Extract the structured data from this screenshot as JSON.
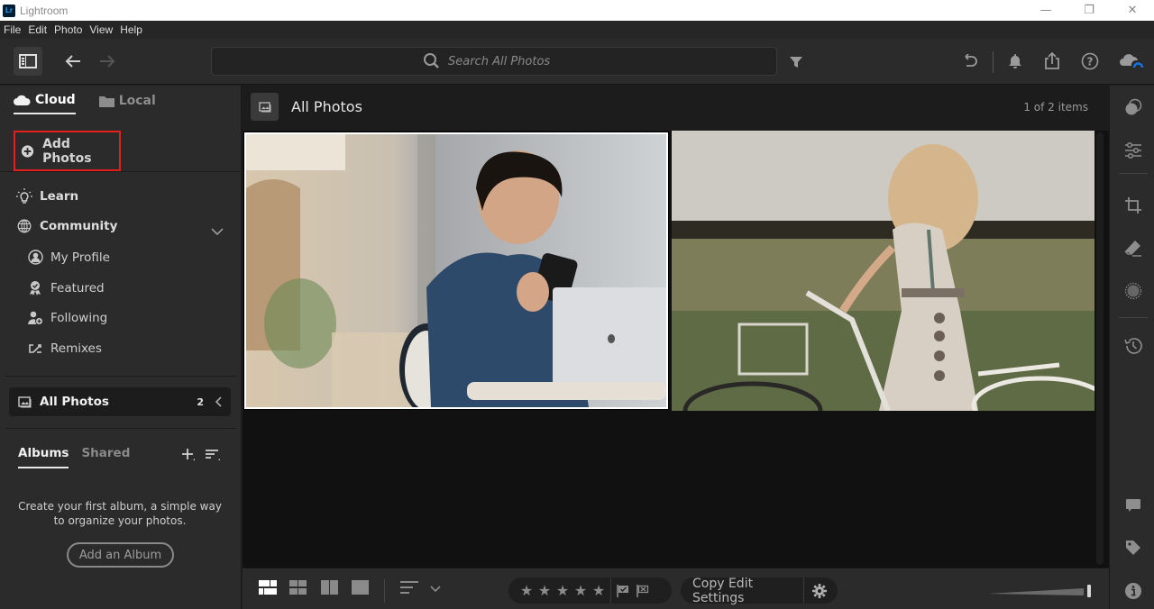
{
  "window": {
    "app_icon_text": "Lr",
    "title": "Lightroom",
    "controls": {
      "minimize": "—",
      "restore": "❐",
      "close": "✕"
    }
  },
  "menu": [
    "File",
    "Edit",
    "Photo",
    "View",
    "Help"
  ],
  "toolbar": {
    "search_placeholder": "Search All Photos",
    "search_value": ""
  },
  "sidebar": {
    "source_tabs": [
      {
        "label": "Cloud",
        "icon": "cloud-icon",
        "active": true
      },
      {
        "label": "Local",
        "icon": "folder-icon",
        "active": false
      }
    ],
    "add_photos_label": "Add Photos",
    "nav": [
      {
        "label": "Learn",
        "icon": "lightbulb-icon"
      },
      {
        "label": "Community",
        "icon": "globe-icon",
        "expanded": true
      }
    ],
    "community_items": [
      {
        "label": "My Profile",
        "icon": "profile-icon"
      },
      {
        "label": "Featured",
        "icon": "award-icon"
      },
      {
        "label": "Following",
        "icon": "following-icon"
      },
      {
        "label": "Remixes",
        "icon": "remix-icon"
      }
    ],
    "all_photos": {
      "label": "All Photos",
      "count": "2"
    },
    "album_tabs": [
      {
        "label": "Albums",
        "active": true
      },
      {
        "label": "Shared",
        "active": false
      }
    ],
    "empty_message": "Create your first album, a simple way to organize your photos.",
    "add_album_label": "Add an Album"
  },
  "main": {
    "title": "All Photos",
    "item_count": "1 of 2 items",
    "photos": [
      {
        "description": "Young man in denim shirt smiling at phone with laptop in cafe",
        "selected": true
      },
      {
        "description": "Woman with curly blonde hair in white dress holding bicycle in field",
        "selected": false
      }
    ]
  },
  "bottombar": {
    "view_modes": [
      "square-grid-active",
      "square-grid",
      "compare",
      "detail"
    ],
    "rating_max": 5,
    "rating_value": 0,
    "copy_edit_label": "Copy Edit Settings",
    "thumbnail_size": 1.0
  },
  "colors": {
    "highlight_box": "#e3201b",
    "sync_accent": "#1473e6"
  }
}
